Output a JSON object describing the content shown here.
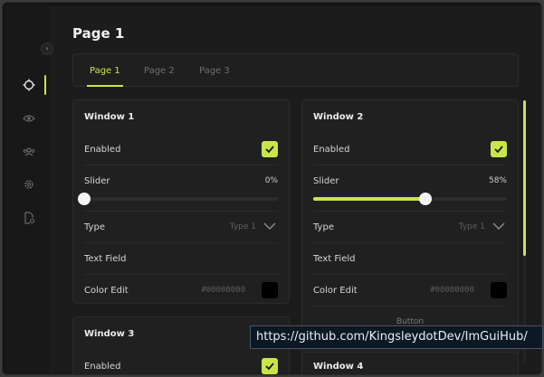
{
  "page_title": "Page 1",
  "tabs": [
    {
      "label": "Page 1"
    },
    {
      "label": "Page 2"
    },
    {
      "label": "Page 3"
    }
  ],
  "sidebar": {
    "collapse_icon": "chevron-right-icon",
    "items": [
      {
        "icon": "crosshair-icon",
        "active": true
      },
      {
        "icon": "eye-icon"
      },
      {
        "icon": "users-icon"
      },
      {
        "icon": "gear-icon"
      },
      {
        "icon": "file-settings-icon"
      }
    ]
  },
  "window1": {
    "title": "Window 1",
    "enabled_label": "Enabled",
    "slider_label": "Slider",
    "slider_value": "0%",
    "slider_fraction": 0.0,
    "type_label": "Type",
    "type_value": "Type 1",
    "textfield_label": "Text Field",
    "color_label": "Color Edit",
    "color_hex": "#00000000"
  },
  "window2": {
    "title": "Window 2",
    "enabled_label": "Enabled",
    "slider_label": "Slider",
    "slider_value": "58%",
    "slider_fraction": 0.58,
    "type_label": "Type",
    "type_value": "Type 1",
    "textfield_label": "Text Field",
    "color_label": "Color Edit",
    "color_hex": "#00000000",
    "button_label": "Button"
  },
  "window3": {
    "title": "Window 3",
    "enabled_label": "Enabled"
  },
  "window4": {
    "title": "Window 4"
  },
  "tooltip": "https://github.com/KingsleydotDev/ImGuiHub/",
  "colors": {
    "accent": "#c8e64a",
    "background": "#1c1c1c",
    "panel": "#202020"
  }
}
